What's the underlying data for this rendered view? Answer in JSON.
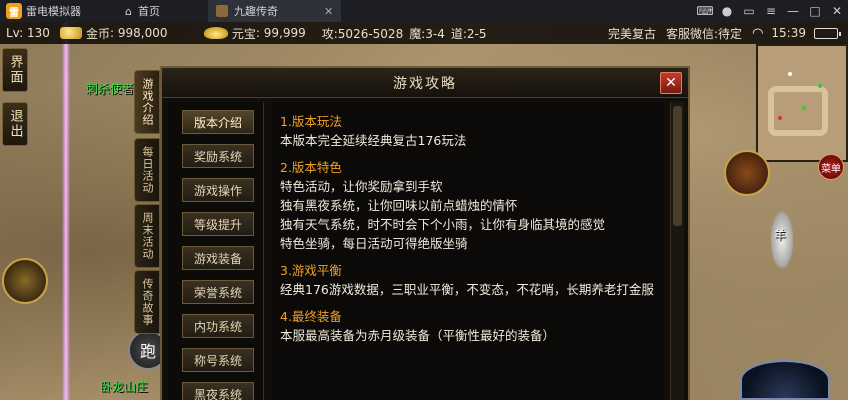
{
  "emulator": {
    "app_name": "雷电模拟器",
    "tabs": [
      {
        "label": "首页"
      },
      {
        "label": "九趣传奇"
      }
    ],
    "controls": [
      "gamepad-icon",
      "account-icon",
      "keyboard-icon",
      "menu-icon",
      "minimize-icon",
      "maximize-icon",
      "close-icon"
    ]
  },
  "hud": {
    "level": "Lv: 130",
    "gold_label": "金币",
    "gold_value": "998,000",
    "yuanbao_label": "元宝",
    "yuanbao_value": "99,999",
    "attack": "攻:5026-5028",
    "magic": "魔:3-4",
    "taoism": "道:2-5",
    "server": "完美复古",
    "service": "客服微信:待定",
    "clock": "15:39"
  },
  "left_buttons": [
    "界面",
    "退出"
  ],
  "npc": {
    "name_top": "刺杀使者",
    "name_bottom": "卧龙山庄"
  },
  "run_label": "跑",
  "right": {
    "red_button_label": "菜单",
    "sheep_label": "羊"
  },
  "side_tabs": [
    "游戏介绍",
    "每日活动",
    "周末活动",
    "传奇故事"
  ],
  "dialog": {
    "title": "游戏攻略",
    "close_label": "✕",
    "menu": [
      "版本介绍",
      "奖励系统",
      "游戏操作",
      "等级提升",
      "游戏装备",
      "荣誉系统",
      "内功系统",
      "称号系统",
      "黑夜系统"
    ],
    "content": {
      "sections": [
        {
          "title": "1.版本玩法",
          "lines": [
            "本版本完全延续经典复古176玩法"
          ]
        },
        {
          "title": "2.版本特色",
          "lines": [
            "特色活动，让你奖励拿到手软",
            "独有黑夜系统，让你回味以前点蜡烛的情怀",
            "独有天气系统，时不时会下个小雨，让你有身临其境的感觉",
            "特色坐骑，每日活动可得绝版坐骑"
          ]
        },
        {
          "title": "3.游戏平衡",
          "lines": [
            "经典176游戏数据，三职业平衡，不变态，不花哨，长期养老打金服"
          ]
        },
        {
          "title": "4.最终装备",
          "lines": [
            "本服最高装备为赤月级装备（平衡性最好的装备）"
          ]
        }
      ]
    }
  }
}
